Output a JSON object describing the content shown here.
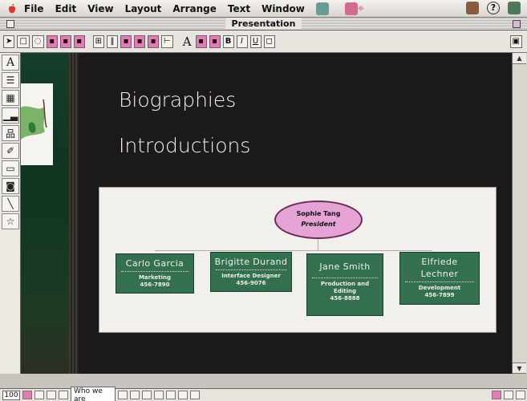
{
  "menubar": {
    "items": [
      "File",
      "Edit",
      "View",
      "Layout",
      "Arrange",
      "Text",
      "Window"
    ]
  },
  "window": {
    "title": "Presentation"
  },
  "slide": {
    "bullets": [
      "Biographies",
      "Introductions"
    ],
    "org_chart": {
      "president": {
        "name": "Sophie Tang",
        "title": "President"
      },
      "employees": [
        {
          "name": "Carlo Garcia",
          "role": "Marketing",
          "phone": "456-7890"
        },
        {
          "name": "Brigitte Durand",
          "role": "Interface Designer",
          "phone": "456-9076"
        },
        {
          "name": "Jane Smith",
          "role": "Production and Editing",
          "phone": "456-8888"
        },
        {
          "name": "Elfriede Lechner",
          "role": "Development",
          "phone": "456-7899"
        }
      ]
    }
  },
  "statusbar": {
    "zoom": "100",
    "page_label": "Who we are"
  },
  "colors": {
    "node_green": "#33704f",
    "president_pink": "#e6a3d6",
    "slide_bg": "#1c1a19",
    "panel_bg": "#f1f0ec"
  }
}
